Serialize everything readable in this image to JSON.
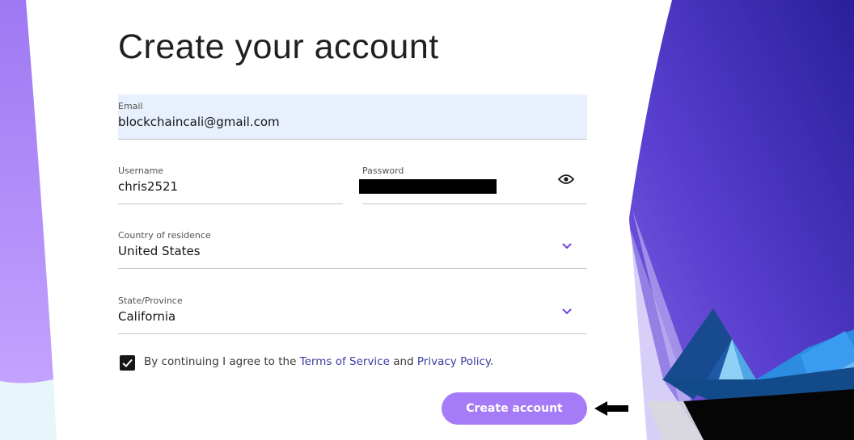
{
  "page": {
    "title": "Create your account"
  },
  "form": {
    "email": {
      "label": "Email",
      "value": "blockchaincali@gmail.com"
    },
    "username": {
      "label": "Username",
      "value": "chris2521"
    },
    "password": {
      "label": "Password"
    },
    "country": {
      "label": "Country of residence",
      "value": "United States"
    },
    "state": {
      "label": "State/Province",
      "value": "California"
    }
  },
  "consent": {
    "checked": true,
    "text_before": "By continuing I agree to the ",
    "terms_link": "Terms of Service",
    "text_middle": " and ",
    "privacy_link": "Privacy Policy",
    "text_after": "."
  },
  "actions": {
    "create_label": "Create account"
  },
  "icons": {
    "password_toggle": "eye-icon",
    "dropdown": "chevron-down-icon",
    "checkbox": "checkmark-icon",
    "pointer": "arrow-left-icon"
  },
  "colors": {
    "accent": "#a57bf7",
    "link": "#3c3ca3",
    "chevron": "#6f42e8",
    "autofill_bg": "#e8f0fe",
    "hero_dark": "#2a1f9a"
  }
}
